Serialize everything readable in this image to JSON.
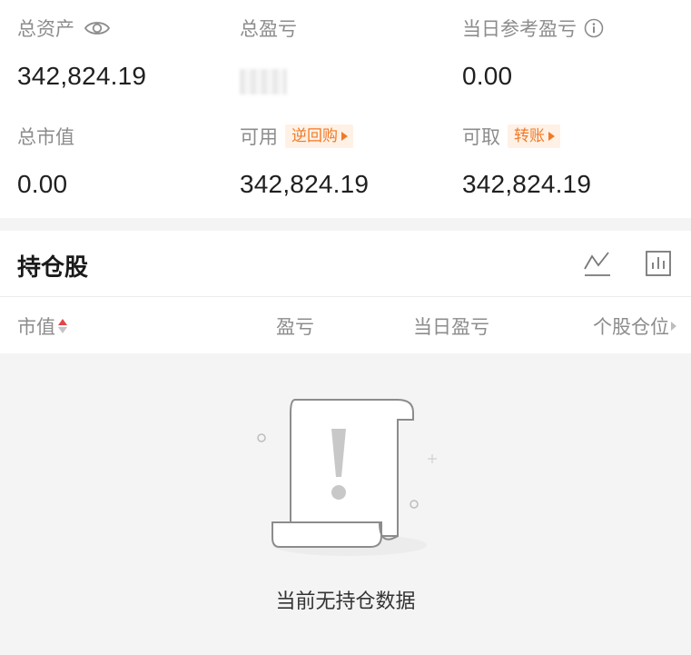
{
  "summary": {
    "total_assets": {
      "label": "总资产",
      "value": "342,824.19",
      "icon": "eye-icon"
    },
    "total_pnl": {
      "label": "总盈亏",
      "value": ""
    },
    "daily_ref_pnl": {
      "label": "当日参考盈亏",
      "value": "0.00",
      "icon": "info-icon"
    },
    "market_value": {
      "label": "总市值",
      "value": "0.00"
    },
    "available": {
      "label": "可用",
      "tag": "逆回购",
      "value": "342,824.19"
    },
    "withdrawable": {
      "label": "可取",
      "tag": "转账",
      "value": "342,824.19"
    }
  },
  "holdings": {
    "title": "持仓股",
    "icons": [
      "line-chart-icon",
      "bar-chart-icon"
    ],
    "columns": [
      "市值",
      "盈亏",
      "当日盈亏",
      "个股仓位"
    ]
  },
  "empty_state": {
    "text": "当前无持仓数据"
  },
  "colors": {
    "accent": "#f07a26",
    "tag_bg": "#fff1e6",
    "sort_active": "#e0454a"
  }
}
